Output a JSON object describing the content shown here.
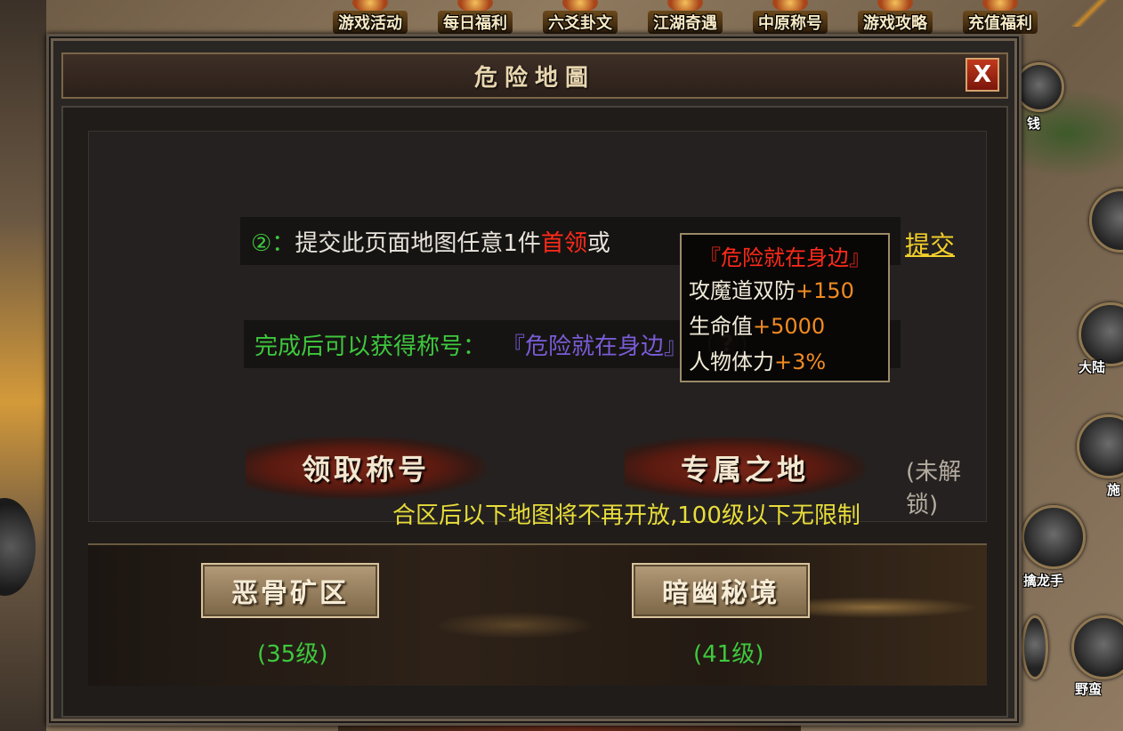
{
  "top_menu": [
    {
      "label": "游戏活动"
    },
    {
      "label": "每日福利"
    },
    {
      "label": "六爻卦文"
    },
    {
      "label": "江湖奇遇"
    },
    {
      "label": "中原称号"
    },
    {
      "label": "游戏攻略"
    },
    {
      "label": "充值福利"
    }
  ],
  "side_labels": {
    "money": "钱",
    "continent": "大陆",
    "land": "施",
    "dragon_hand": "擒龙手",
    "wild": "野蛮"
  },
  "dialog": {
    "title": "危险地圖",
    "close_label": "X",
    "task": {
      "number": "②：",
      "text_before": "提交此页面地图任意1件 ",
      "highlight": "首领",
      "text_after": "或"
    },
    "submit_label": "提交",
    "reward": {
      "prefix": "完成后可以获得称号：",
      "title_name": "『危险就在身边』",
      "help_label": "?"
    },
    "tooltip": {
      "title": "『危险就在身边』",
      "lines": [
        {
          "name": "攻魔道双防",
          "value": "+150"
        },
        {
          "name": "生命值",
          "value": "+5000"
        },
        {
          "name": "人物体力",
          "value": "+3%"
        }
      ]
    },
    "claim_button": "领取称号",
    "exclusive_button": "专属之地",
    "locked_text": "(未解锁)",
    "notice": "合区后以下地图将不再开放,100级以下无限制",
    "maps": [
      {
        "name": "恶骨矿区",
        "level": "(35级)"
      },
      {
        "name": "暗幽秘境",
        "level": "(41级)"
      }
    ]
  }
}
